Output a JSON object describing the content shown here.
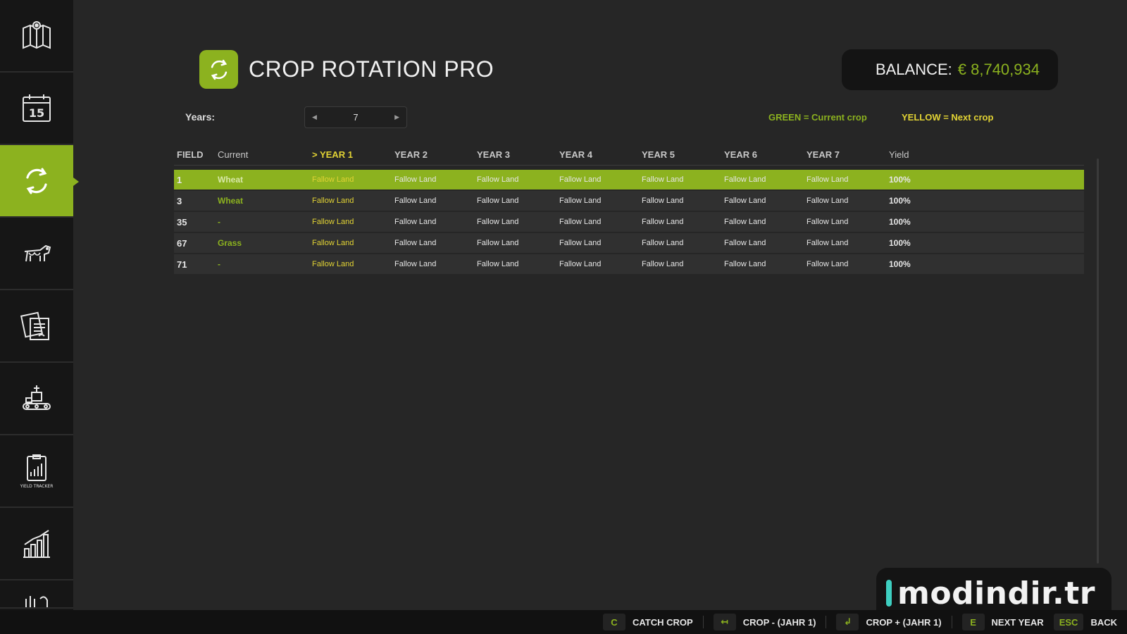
{
  "sidebar": {
    "items": [
      {
        "icon": "map-icon",
        "active": false
      },
      {
        "icon": "calendar-icon",
        "label": "15",
        "active": false
      },
      {
        "icon": "crop-rotation-icon",
        "active": true
      },
      {
        "icon": "animals-icon",
        "active": false
      },
      {
        "icon": "contracts-icon",
        "active": false
      },
      {
        "icon": "production-icon",
        "active": false
      },
      {
        "icon": "yield-tracker-icon",
        "label": "YIELD TRACKER",
        "active": false
      },
      {
        "icon": "statistics-icon",
        "active": false
      },
      {
        "icon": "more-icon",
        "active": false
      }
    ]
  },
  "header": {
    "title": "CROP ROTATION PRO",
    "balance_label": "BALANCE:",
    "balance_value": "€ 8,740,934"
  },
  "controls": {
    "years_label": "Years:",
    "years_value": "7",
    "legend_green": "GREEN = Current crop",
    "legend_yellow": "YELLOW = Next crop"
  },
  "table": {
    "headers": {
      "field": "FIELD",
      "current": "Current",
      "years": [
        "> YEAR 1",
        "YEAR 2",
        "YEAR 3",
        "YEAR 4",
        "YEAR 5",
        "YEAR 6",
        "YEAR 7"
      ],
      "yield": "Yield"
    },
    "rows": [
      {
        "field": "1",
        "current": "Wheat",
        "years": [
          "Fallow Land",
          "Fallow Land",
          "Fallow Land",
          "Fallow Land",
          "Fallow Land",
          "Fallow Land",
          "Fallow Land"
        ],
        "yield": "100%",
        "selected": true
      },
      {
        "field": "3",
        "current": "Wheat",
        "years": [
          "Fallow Land",
          "Fallow Land",
          "Fallow Land",
          "Fallow Land",
          "Fallow Land",
          "Fallow Land",
          "Fallow Land"
        ],
        "yield": "100%",
        "selected": false
      },
      {
        "field": "35",
        "current": "-",
        "years": [
          "Fallow Land",
          "Fallow Land",
          "Fallow Land",
          "Fallow Land",
          "Fallow Land",
          "Fallow Land",
          "Fallow Land"
        ],
        "yield": "100%",
        "selected": false
      },
      {
        "field": "67",
        "current": "Grass",
        "years": [
          "Fallow Land",
          "Fallow Land",
          "Fallow Land",
          "Fallow Land",
          "Fallow Land",
          "Fallow Land",
          "Fallow Land"
        ],
        "yield": "100%",
        "selected": false
      },
      {
        "field": "71",
        "current": "-",
        "years": [
          "Fallow Land",
          "Fallow Land",
          "Fallow Land",
          "Fallow Land",
          "Fallow Land",
          "Fallow Land",
          "Fallow Land"
        ],
        "yield": "100%",
        "selected": false
      }
    ]
  },
  "footer": {
    "hints": [
      {
        "key": "C",
        "label": "CATCH CROP"
      },
      {
        "key": "↤",
        "label": "CROP - (JAHR 1)"
      },
      {
        "key": "↲",
        "label": "CROP + (JAHR 1)"
      },
      {
        "key": "E",
        "label": "NEXT YEAR"
      },
      {
        "key": "ESC",
        "label": "BACK"
      }
    ]
  },
  "watermark": {
    "text": "modindir.tr"
  },
  "colors": {
    "accent": "#8cb21f",
    "next_crop": "#e2d334",
    "background": "#262626",
    "sidebar": "#161616"
  }
}
